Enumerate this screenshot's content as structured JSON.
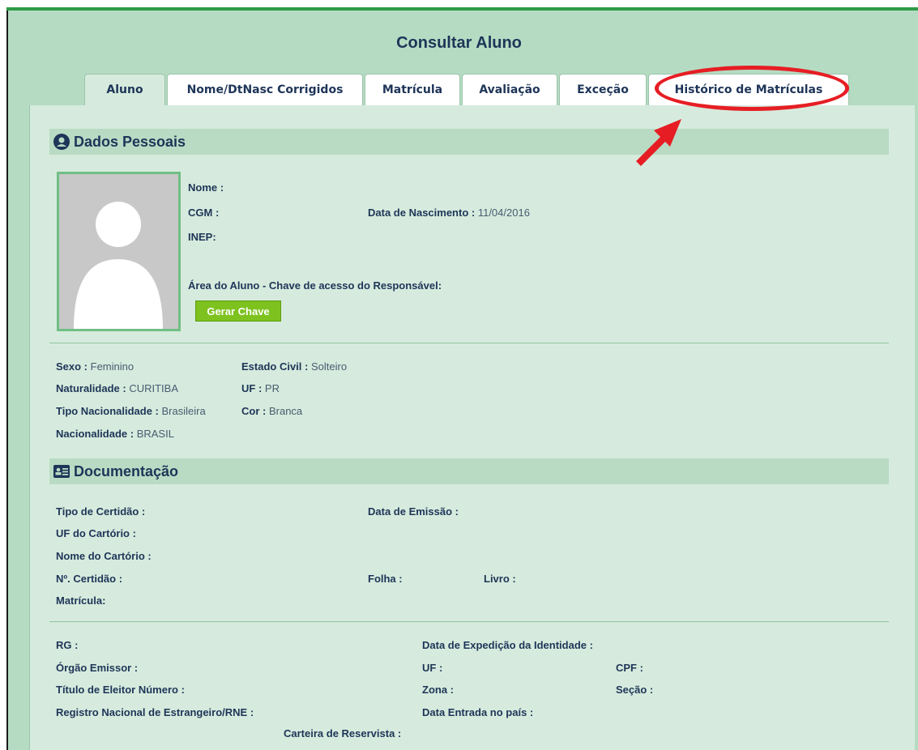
{
  "page": {
    "title": "Consultar Aluno"
  },
  "tabs": [
    {
      "label": "Aluno"
    },
    {
      "label": "Nome/DtNasc Corrigidos"
    },
    {
      "label": "Matrícula"
    },
    {
      "label": "Avaliação"
    },
    {
      "label": "Exceção"
    },
    {
      "label": "Histórico de Matrículas"
    }
  ],
  "dados_pessoais": {
    "title": "Dados Pessoais",
    "nome_label": "Nome :",
    "cgm_label": "CGM :",
    "inep_label": "INEP:",
    "nasc_label": "Data de Nascimento :",
    "nasc_value": "11/04/2016",
    "area_label": "Área do Aluno - Chave de acesso do Responsável:",
    "gerar_button": "Gerar Chave",
    "sexo_label": "Sexo :",
    "sexo_value": "Feminino",
    "natural_label": "Naturalidade :",
    "natural_value": "CURITIBA",
    "tipo_nac_label": "Tipo Nacionalidade :",
    "tipo_nac_value": "Brasileira",
    "nac_label": "Nacionalidade :",
    "nac_value": "BRASIL",
    "estado_civil_label": "Estado Civil :",
    "estado_civil_value": "Solteiro",
    "uf_label": "UF :",
    "uf_value": "PR",
    "cor_label": "Cor :",
    "cor_value": "Branca"
  },
  "documentacao": {
    "title": "Documentação",
    "tipo_cert": "Tipo de Certidão :",
    "data_emissao": "Data de Emissão :",
    "uf_cartorio": "UF do Cartório :",
    "nome_cartorio": "Nome do Cartório :",
    "num_cert": "Nº. Certidão :",
    "folha": "Folha :",
    "livro": "Livro :",
    "matricula": "Matrícula:",
    "rg": "RG :",
    "data_exp": "Data de Expedição da Identidade :",
    "orgao": "Órgão Emissor :",
    "uf": "UF :",
    "cpf": "CPF :",
    "titulo": "Título de Eleitor Número :",
    "zona": "Zona :",
    "secao": "Seção :",
    "rne": "Registro Nacional de Estrangeiro/RNE :",
    "data_entrada": "Data Entrada no país :",
    "reservista": "Carteira de Reservista :"
  },
  "colors": {
    "accent": "#2e9a48",
    "highlight": "#e61e24",
    "button": "#7ec21f"
  },
  "icons": [
    "user-circle-icon",
    "id-card-icon",
    "arrow-icon"
  ]
}
